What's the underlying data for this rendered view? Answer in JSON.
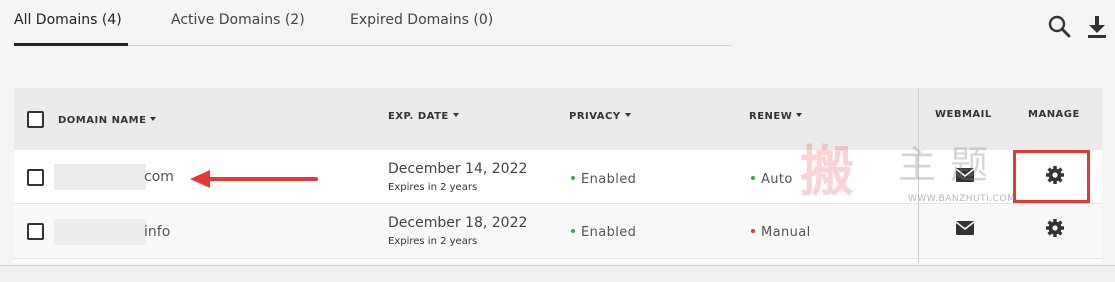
{
  "tabs": [
    {
      "label": "All Domains (4)",
      "active": true
    },
    {
      "label": "Active Domains (2)",
      "active": false
    },
    {
      "label": "Expired Domains (0)",
      "active": false
    }
  ],
  "toolbar": {
    "search_icon": "search-icon",
    "download_icon": "download-icon"
  },
  "table": {
    "headers": {
      "domain": "DOMAIN NAME",
      "exp_date": "EXP. DATE",
      "privacy": "PRIVACY",
      "renew": "RENEW",
      "webmail": "WEBMAIL",
      "manage": "MANAGE"
    },
    "rows": [
      {
        "domain_suffix": "com",
        "exp_date": "December 14, 2022",
        "expires_in": "Expires in 2 years",
        "privacy": "Enabled",
        "renew": "Auto"
      },
      {
        "domain_suffix": "info",
        "exp_date": "December 18, 2022",
        "expires_in": "Expires in 2 years",
        "privacy": "Enabled",
        "renew": "Manual"
      }
    ]
  },
  "watermark": {
    "chars": "搬主题",
    "url": "WWW.BANZHUTI.COM"
  },
  "colors": {
    "enabled": "#43a047",
    "auto": "#43a047",
    "manual": "#e53935",
    "highlight": "#e53935",
    "arrow": "#e53935"
  }
}
